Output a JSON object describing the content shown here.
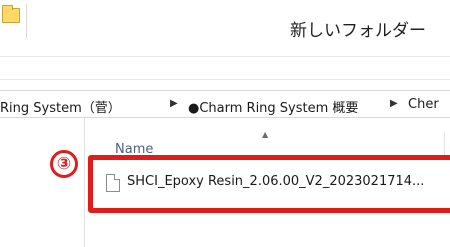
{
  "window": {
    "title": "新しいフォルダー",
    "folder_icon": "folder-icon"
  },
  "address_bar": {
    "crumbs": [
      "Ring System（菅）",
      "●Charm Ring System 概要",
      "Cher"
    ],
    "separator_icon": "chevron-right-icon"
  },
  "file_list": {
    "sort_indicator_icon": "sort-up-icon",
    "column_header": "Name",
    "items": [
      {
        "name": "SHCI_Epoxy Resin_2.06.00_V2_2023021714...",
        "icon": "document-icon"
      }
    ]
  },
  "annotation": {
    "step_number": "③",
    "color": "#e41b1b"
  }
}
